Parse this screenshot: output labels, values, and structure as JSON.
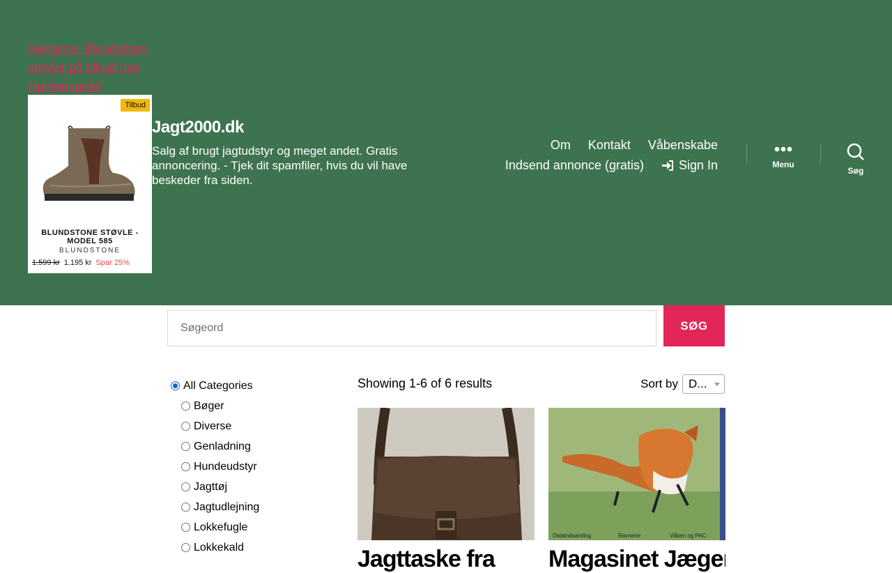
{
  "ad": {
    "link_text": "Reklame: Blundstone støvler på tilbud hos Huntenspoint",
    "badge": "Tilbud",
    "product_name": "BLUNDSTONE STØVLE - MODEL 585",
    "brand": "BLUNDSTONE",
    "old_price": "1.599 kr",
    "new_price": "1.195 kr",
    "saving": "Spar 25%"
  },
  "site": {
    "title": "Jagt2000.dk",
    "description": "Salg af brugt jagtudstyr og meget andet. Gratis annoncering. - Tjek dit spamfiler, hvis du vil have beskeder fra siden."
  },
  "nav": {
    "items": [
      "Om",
      "Kontakt",
      "Våbenskabe",
      "Indsend annonce (gratis)"
    ],
    "signin": "Sign In"
  },
  "toggles": {
    "menu": "Menu",
    "search": "Søg"
  },
  "search": {
    "placeholder": "Søgeord",
    "button": "SØG"
  },
  "categories": {
    "all": "All Categories",
    "items": [
      "Bøger",
      "Diverse",
      "Genladning",
      "Hundeudstyr",
      "Jagttøj",
      "Jagtudlejning",
      "Lokkefugle",
      "Lokkekald"
    ]
  },
  "results": {
    "count_text": "Showing 1-6 of 6 results",
    "sort_label": "Sort by",
    "sort_value": "D..."
  },
  "listings": [
    {
      "title": "Jagttaske fra"
    },
    {
      "title": "Magasinet Jæger",
      "captions": [
        "Dataindsamling",
        "Ravnene",
        "Våben og PAC"
      ]
    }
  ],
  "colors": {
    "header_bg": "#3e734f",
    "accent": "#e22658",
    "radio_checked": "#0b63d8"
  }
}
